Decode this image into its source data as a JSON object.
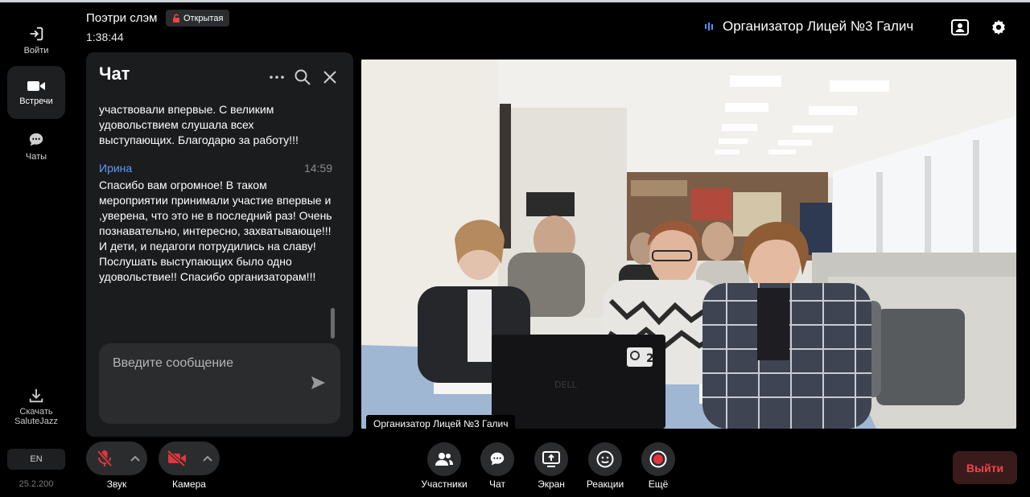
{
  "rail": {
    "login": "Войти",
    "meetings": "Встречи",
    "chats": "Чаты",
    "download": "Скачать SaluteJazz",
    "language": "EN",
    "version": "25.2.200"
  },
  "header": {
    "meeting_title": "Поэтри слэм",
    "badge": "Открытая",
    "timer": "1:38:44",
    "speaker": "Организатор Лицей №3 Галич"
  },
  "chat": {
    "title": "Чат",
    "messages": [
      {
        "text": "участвовали впервые. С великим удовольствием слушала всех выступающих. Благодарю за работу!!!"
      },
      {
        "author": "Ирина",
        "time": "14:59",
        "text": "Спасибо вам огромное! В таком мероприятии принимали участие впервые и ,уверена, что это не в последний раз! Очень познавательно, интересно, захватывающе!!! И дети, и педагоги потрудились на славу! Послушать выступающих  было одно удовольствие!! Спасибо организаторам!!!"
      }
    ],
    "input_placeholder": "Введите сообщение"
  },
  "video": {
    "participant": "Организатор Лицей №3 Галич",
    "laptop_sticker": "2"
  },
  "toolbar": {
    "sound": "Звук",
    "camera": "Камера",
    "participants": "Участники",
    "chat": "Чат",
    "screen": "Экран",
    "reactions": "Реакции",
    "more": "Ещё",
    "exit": "Выйти"
  },
  "colors": {
    "accent_blue": "#5d9cf8",
    "muted_red": "#f2444a",
    "record_red": "#e5343c",
    "panel": "#1b1c1e"
  }
}
